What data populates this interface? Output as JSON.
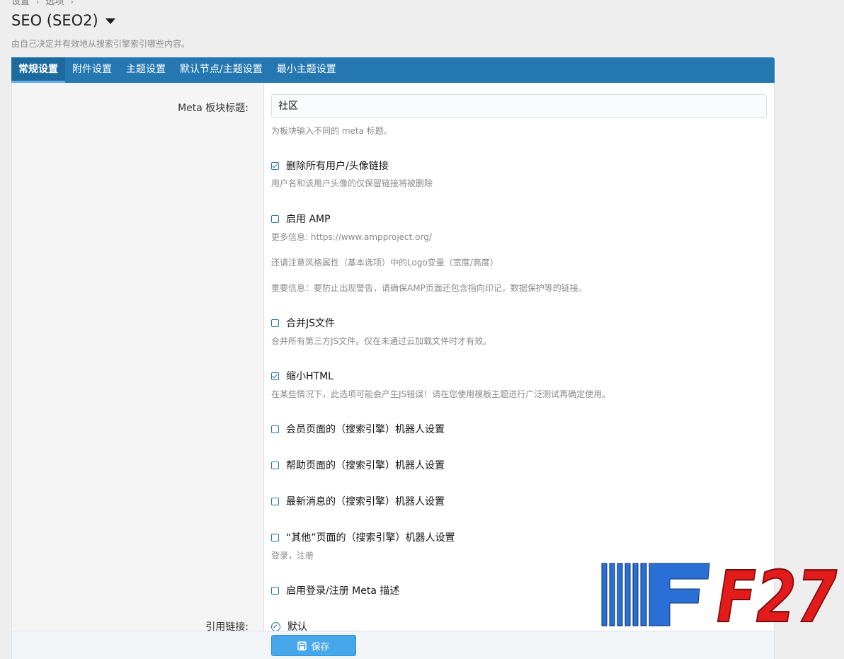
{
  "breadcrumb": [
    "设置",
    "选项"
  ],
  "page": {
    "title": "SEO (SEO2)",
    "description": "由自己决定并有效地从搜索引擎索引哪些内容。"
  },
  "tabs": [
    {
      "label": "常规设置",
      "active": true
    },
    {
      "label": "附件设置",
      "active": false
    },
    {
      "label": "主题设置",
      "active": false
    },
    {
      "label": "默认节点/主题设置",
      "active": false
    },
    {
      "label": "最小主题设置",
      "active": false
    }
  ],
  "form": {
    "meta_title_label": "Meta 板块标题:",
    "meta_title_value": "社区",
    "meta_title_hint": "为板块输入不同的 meta 标题。",
    "options": [
      {
        "label": "删除所有用户/头像链接",
        "checked": true,
        "hints": [
          "用户名和该用户头像的仅保留链接将被删除"
        ]
      },
      {
        "label": "启用 AMP",
        "checked": false,
        "hints": [
          "更多信息: https://www.ampproject.org/",
          "还请注意风格属性（基本选项）中的Logo变量（宽度/高度）",
          "重要信息：要防止出现警告，请确保AMP页面还包含指向印记，数据保护等的链接。"
        ]
      },
      {
        "label": "合并JS文件",
        "checked": false,
        "hints": [
          "合并所有第三方JS文件。仅在未通过云加载文件时才有效。"
        ]
      },
      {
        "label": "缩小HTML",
        "checked": true,
        "hints": [
          "在某些情况下，此选项可能会产生JS错误！请在您使用模板主题进行广泛测试再确定使用。"
        ]
      },
      {
        "label": "会员页面的（搜索引擎）机器人设置",
        "checked": false,
        "hints": []
      },
      {
        "label": "帮助页面的（搜索引擎）机器人设置",
        "checked": false,
        "hints": []
      },
      {
        "label": "最新消息的（搜索引擎）机器人设置",
        "checked": false,
        "hints": []
      },
      {
        "label": "“其他”页面的（搜索引擎）机器人设置",
        "checked": false,
        "hints": [
          "登录，注册"
        ]
      },
      {
        "label": "启用登录/注册 Meta 描述",
        "checked": false,
        "hints": []
      }
    ],
    "canonical_label": "引用链接:",
    "canonical_option": "默认"
  },
  "footer": {
    "save_label": "保存"
  },
  "watermark": {
    "text": "F27"
  },
  "colors": {
    "accent": "#2577b1",
    "button": "#47a7eb",
    "watermark_red": "#e31b1b",
    "watermark_blue": "#2a6fd6"
  }
}
